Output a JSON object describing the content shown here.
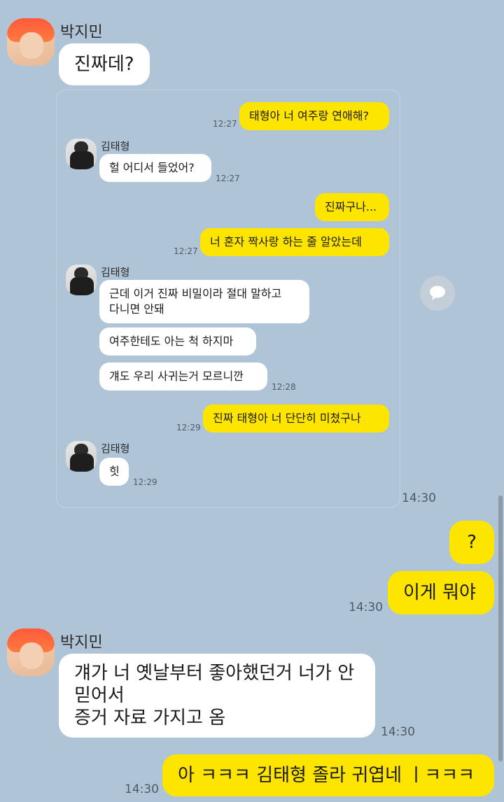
{
  "top": {
    "sender_name": "박지민",
    "message": "진짜데?"
  },
  "shared": {
    "m1": "태형아 너 여주랑 연애해?",
    "m1_time": "12:27",
    "name1": "김태형",
    "m2": "헐 어디서 들었어?",
    "m2_time": "12:27",
    "m3": "진짜구나...",
    "m4": "너 혼자 짝사랑 하는 줄 알았는데",
    "m4_time": "12:27",
    "name2": "김태형",
    "m5": "근데 이거 진짜 비밀이라 절대 말하고\n다니면 안돼",
    "m6": "여주한테도 아는 척 하지마",
    "m7": "걔도 우리 사귀는거 모르니깐",
    "m7_time": "12:28",
    "m8": "진짜 태형아 너 단단히 미쳤구나",
    "m8_time": "12:29",
    "name3": "김태형",
    "m9": "힛",
    "m9_time": "12:29",
    "card_time": "14:30"
  },
  "me1": "?",
  "me2": "이게 뭐야",
  "me2_time": "14:30",
  "bottom": {
    "sender_name": "박지민",
    "message": "걔가 너 옛날부터 좋아했던거 너가 안\n믿어서\n증거 자료 가지고 옴",
    "time": "14:30"
  },
  "me3": "아 ㅋㅋㅋ 김태형 졸라 귀엽네 ㅣㅋㅋㅋ",
  "me3_time": "14:30",
  "icons": {
    "share": "share-chat-icon"
  },
  "colors": {
    "background": "#b0c4d7",
    "my_bubble": "#fee500",
    "their_bubble": "#ffffff"
  }
}
